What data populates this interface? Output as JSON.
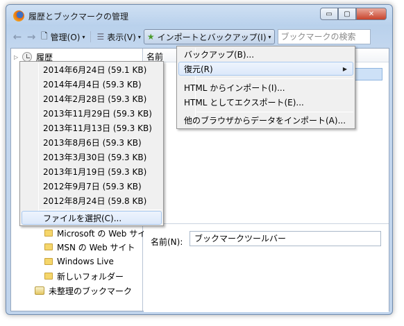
{
  "window": {
    "title": "履歴とブックマークの管理",
    "min": "▭",
    "max": "▢",
    "close": "✕"
  },
  "toolbar": {
    "organize": "管理(O)",
    "views": "表示(V)",
    "import_backup": "インポートとバックアップ(I)",
    "search_placeholder": "ブックマークの検索"
  },
  "tree": {
    "history": "履歴",
    "items": [
      {
        "label": "Microsoft の Web サイト"
      },
      {
        "label": "MSN の Web サイト"
      },
      {
        "label": "Windows Live"
      },
      {
        "label": "新しいフォルダー"
      }
    ],
    "unsorted": "未整理のブックマーク"
  },
  "columns": {
    "name": "名前"
  },
  "details": {
    "name_label": "名前(N):",
    "name_value": "ブックマークツールバー"
  },
  "import_menu": {
    "backup": "バックアップ(B)...",
    "restore": "復元(R)",
    "import_html": "HTML からインポート(I)...",
    "export_html": "HTML としてエクスポート(E)...",
    "import_other": "他のブラウザからデータをインポート(A)..."
  },
  "restore_menu": {
    "backups": [
      "2014年6月24日 (59.1 KB)",
      "2014年4月4日 (59.3 KB)",
      "2014年2月28日 (59.3 KB)",
      "2013年11月29日 (59.3 KB)",
      "2013年11月13日 (59.3 KB)",
      "2013年8月6日 (59.3 KB)",
      "2013年3月30日 (59.3 KB)",
      "2013年1月19日 (59.3 KB)",
      "2012年9月7日 (59.3 KB)",
      "2012年8月24日 (59.8 KB)"
    ],
    "choose_file": "ファイルを選択(C)..."
  },
  "colors": {
    "accent": "#cde1f7",
    "window": "#c5d8ef"
  }
}
